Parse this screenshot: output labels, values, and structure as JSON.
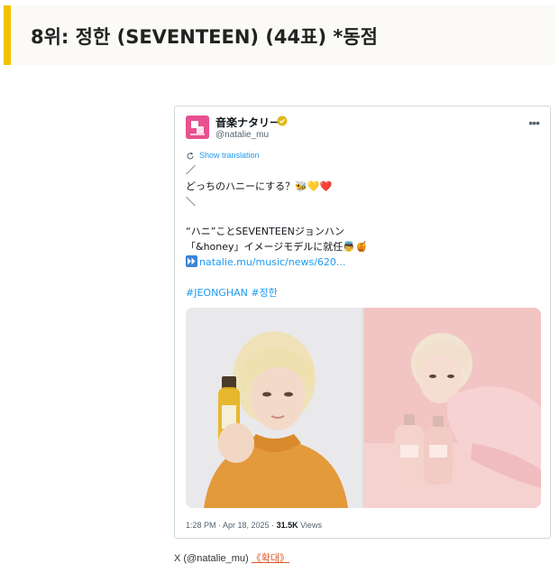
{
  "heading": {
    "text": "8위: 정한 (SEVENTEEN) (44표) *동점",
    "accent_color": "#f2c200"
  },
  "tweet": {
    "account_name": "音楽ナタリー",
    "account_handle": "@natalie_mu",
    "avatar_icon": "natalie-logo-icon",
    "verified_icon": "verified-badge-icon",
    "more_icon": "more-options-icon",
    "show_translation": "Show translation",
    "lines": {
      "slash_top": "／",
      "question": "どっちのハニーにする？",
      "question_emoji": "🐝💛❤️",
      "slash_bottom": "＼",
      "headline1": "“ハニ”ことSEVENTEENジョンハン",
      "headline2": "「&honey」イメージモデルに就任",
      "headline2_emoji": "👼🍯",
      "link": "natalie.mu/music/news/620...",
      "hashtags": "#JEONGHAN #정한"
    },
    "meta": {
      "time": "1:28 PM · Apr 18, 2025 · ",
      "views_count": "31.5K",
      "views_label": " Views"
    },
    "link_color": "#1d9bf0"
  },
  "caption": {
    "prefix": "X (@natalie_mu) ",
    "link": "《확대》"
  }
}
